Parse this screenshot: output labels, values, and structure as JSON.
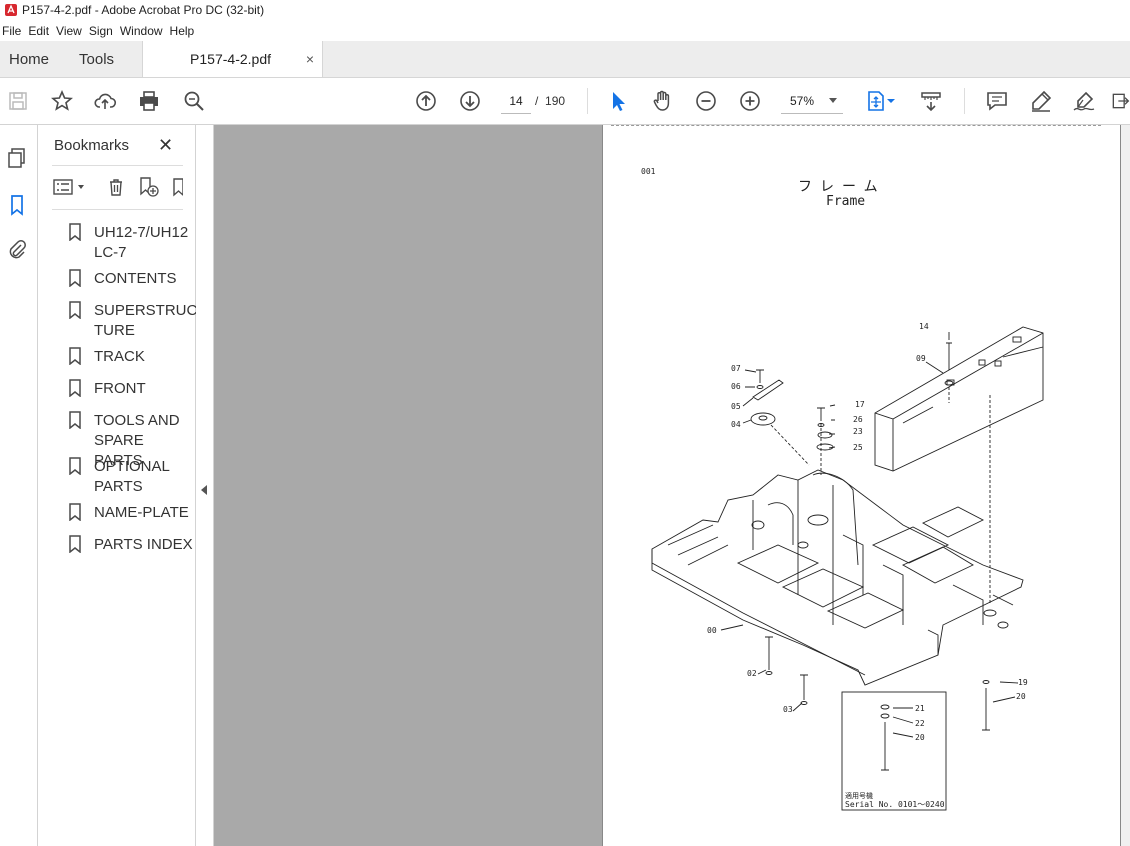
{
  "window": {
    "title": "P157-4-2.pdf - Adobe Acrobat Pro DC (32-bit)"
  },
  "menu": {
    "items": [
      "File",
      "Edit",
      "View",
      "Sign",
      "Window",
      "Help"
    ]
  },
  "tabs": {
    "home": "Home",
    "tools": "Tools",
    "document": "P157-4-2.pdf",
    "close_glyph": "×"
  },
  "toolbar": {
    "current_page": "14",
    "page_separator": "/",
    "total_pages": "190",
    "zoom": "57%"
  },
  "bookmarks": {
    "title": "Bookmarks",
    "close_glyph": "✕",
    "items": [
      {
        "label": "UH12-7/UH12 LC-7"
      },
      {
        "label": "CONTENTS"
      },
      {
        "label": "SUPERSTRUC TURE"
      },
      {
        "label": "TRACK"
      },
      {
        "label": "FRONT"
      },
      {
        "label": "TOOLS AND SPARE PARTS"
      },
      {
        "label": "OPTIONAL PARTS"
      },
      {
        "label": "NAME-PLATE"
      },
      {
        "label": "PARTS INDEX"
      }
    ]
  },
  "pdf_page": {
    "page_code": "001",
    "title_jp": "フレーム",
    "title_en": "Frame",
    "callouts": [
      "14",
      "09",
      "07",
      "06",
      "05",
      "04",
      "17",
      "26",
      "23",
      "25",
      "00",
      "02",
      "03",
      "19",
      "20",
      "21",
      "22",
      "20"
    ],
    "serial_label_jp": "適用号機",
    "serial_text": "Serial No. 0101〜0240"
  },
  "colors": {
    "accent": "#1473e6",
    "viewer_bg": "#a9a9a9",
    "icon": "#4b4b4b"
  }
}
